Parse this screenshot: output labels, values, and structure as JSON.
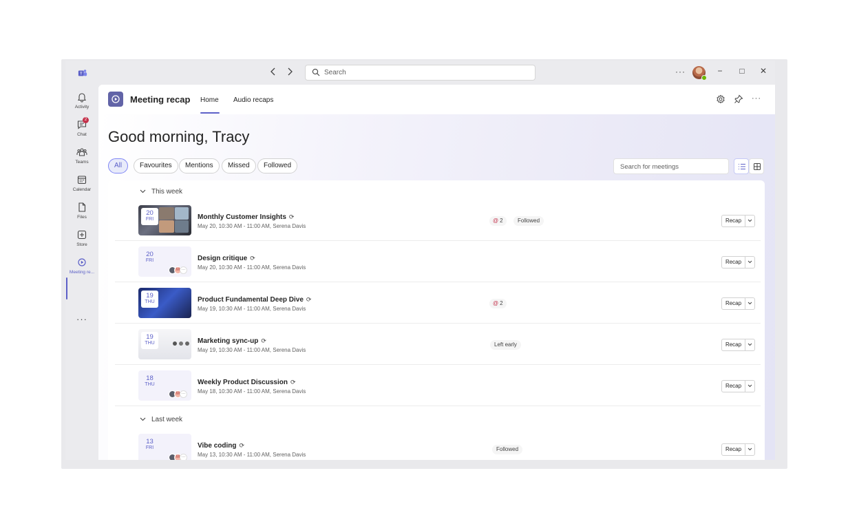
{
  "titlebar": {
    "search_placeholder": "Search",
    "back_icon": "chevron-left-icon",
    "forward_icon": "chevron-right-icon",
    "more_label": "···",
    "minimize_label": "−",
    "maximize_label": "□",
    "close_label": "✕"
  },
  "rail": {
    "items": [
      {
        "label": "Activity",
        "icon": "bell-icon"
      },
      {
        "label": "Chat",
        "icon": "chat-icon",
        "badge": "2"
      },
      {
        "label": "Teams",
        "icon": "teams-icon"
      },
      {
        "label": "Calendar",
        "icon": "calendar-icon"
      },
      {
        "label": "Files",
        "icon": "file-icon"
      },
      {
        "label": "Store",
        "icon": "store-icon"
      },
      {
        "label": "Meeting re...",
        "icon": "meeting-recap-icon"
      }
    ],
    "more_label": "···"
  },
  "app_header": {
    "title": "Meeting recap",
    "tabs": [
      {
        "label": "Home",
        "active": true
      },
      {
        "label": "Audio recaps",
        "active": false
      }
    ],
    "more_label": "···"
  },
  "hero": {
    "greeting": "Good morning, Tracy"
  },
  "filters": {
    "chips": [
      "All",
      "Favourites",
      "Mentions",
      "Missed",
      "Followed"
    ],
    "active": "All",
    "search_placeholder": "Search for meetings"
  },
  "sections": {
    "this_week": "This week",
    "last_week": "Last week"
  },
  "meetings": [
    {
      "day": "20",
      "weekday": "FRI",
      "title": "Monthly Customer Insights",
      "subtitle": "May 20, 10:30 AM - 11:00 AM, Serena Davis",
      "mentions": "2",
      "status": "Followed",
      "recap": "Recap"
    },
    {
      "day": "20",
      "weekday": "FRI",
      "title": "Design critique",
      "subtitle": "May 20, 10:30 AM - 11:00 AM, Serena Davis",
      "mentions": "",
      "status": "",
      "recap": "Recap"
    },
    {
      "day": "19",
      "weekday": "THU",
      "title": "Product Fundamental Deep Dive",
      "subtitle": "May 19, 10:30 AM - 11:00 AM, Serena Davis",
      "mentions": "2",
      "status": "",
      "recap": "Recap"
    },
    {
      "day": "19",
      "weekday": "THU",
      "title": "Marketing sync-up",
      "subtitle": "May 19, 10:30 AM - 11:00 AM, Serena Davis",
      "mentions": "",
      "status": "Left early",
      "recap": "Recap"
    },
    {
      "day": "18",
      "weekday": "THU",
      "title": "Weekly Product Discussion",
      "subtitle": "May 18, 10:30 AM - 11:00 AM, Serena Davis",
      "mentions": "",
      "status": "",
      "recap": "Recap"
    },
    {
      "day": "13",
      "weekday": "FRI",
      "title": "Vibe coding",
      "subtitle": "May 13, 10:30 AM - 11:00 AM, Serena Davis",
      "mentions": "",
      "status": "Followed",
      "recap": "Recap"
    }
  ],
  "colors": {
    "brand": "#5b5fc7",
    "mention": "#c4314b",
    "presence": "#6bb700"
  }
}
